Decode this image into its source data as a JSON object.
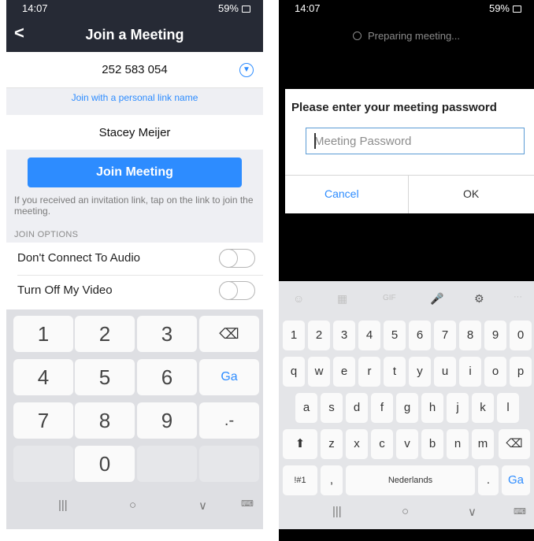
{
  "left": {
    "status": {
      "time": "14:07",
      "battery": "59%"
    },
    "title": "Join a Meeting",
    "meeting_id": "252 583 054",
    "personal_link": "Join with a personal link name",
    "name_value": "Stacey Meijer",
    "join_button": "Join Meeting",
    "hint": "If you received an invitation link, tap on the link to join the meeting.",
    "section_label": "JOIN OPTIONS",
    "options": [
      {
        "label": "Don't Connect To Audio",
        "on": false
      },
      {
        "label": "Turn Off My Video",
        "on": false
      }
    ],
    "numpad": {
      "row1": [
        "1",
        "2",
        "3"
      ],
      "row2": [
        "4",
        "5",
        "6"
      ],
      "row3": [
        "7",
        "8",
        "9"
      ],
      "zero": "0",
      "go": "Ga",
      "punct": ".-"
    },
    "nav": {
      "recents": "|||",
      "home": "○",
      "back": "∨"
    }
  },
  "right": {
    "status": {
      "time": "14:07",
      "battery": "59%"
    },
    "preparing": "Preparing meeting...",
    "dialog": {
      "title": "Please enter your meeting password",
      "placeholder": "Meeting Password",
      "cancel": "Cancel",
      "ok": "OK"
    },
    "keyboard": {
      "toolbar": [
        "☺",
        "▦",
        "GIF",
        "🎤",
        "⚙",
        "···"
      ],
      "numbers": [
        "1",
        "2",
        "3",
        "4",
        "5",
        "6",
        "7",
        "8",
        "9",
        "0"
      ],
      "row1": [
        "q",
        "w",
        "e",
        "r",
        "t",
        "y",
        "u",
        "i",
        "o",
        "p"
      ],
      "row2": [
        "a",
        "s",
        "d",
        "f",
        "g",
        "h",
        "j",
        "k",
        "l"
      ],
      "row3": [
        "z",
        "x",
        "c",
        "v",
        "b",
        "n",
        "m"
      ],
      "symbols": "!#1",
      "comma": ",",
      "space": "Nederlands",
      "period": ".",
      "go": "Ga"
    },
    "nav": {
      "recents": "|||",
      "home": "○",
      "back": "∨"
    }
  },
  "colors": {
    "accent": "#2d8cff",
    "header": "#262a35"
  }
}
